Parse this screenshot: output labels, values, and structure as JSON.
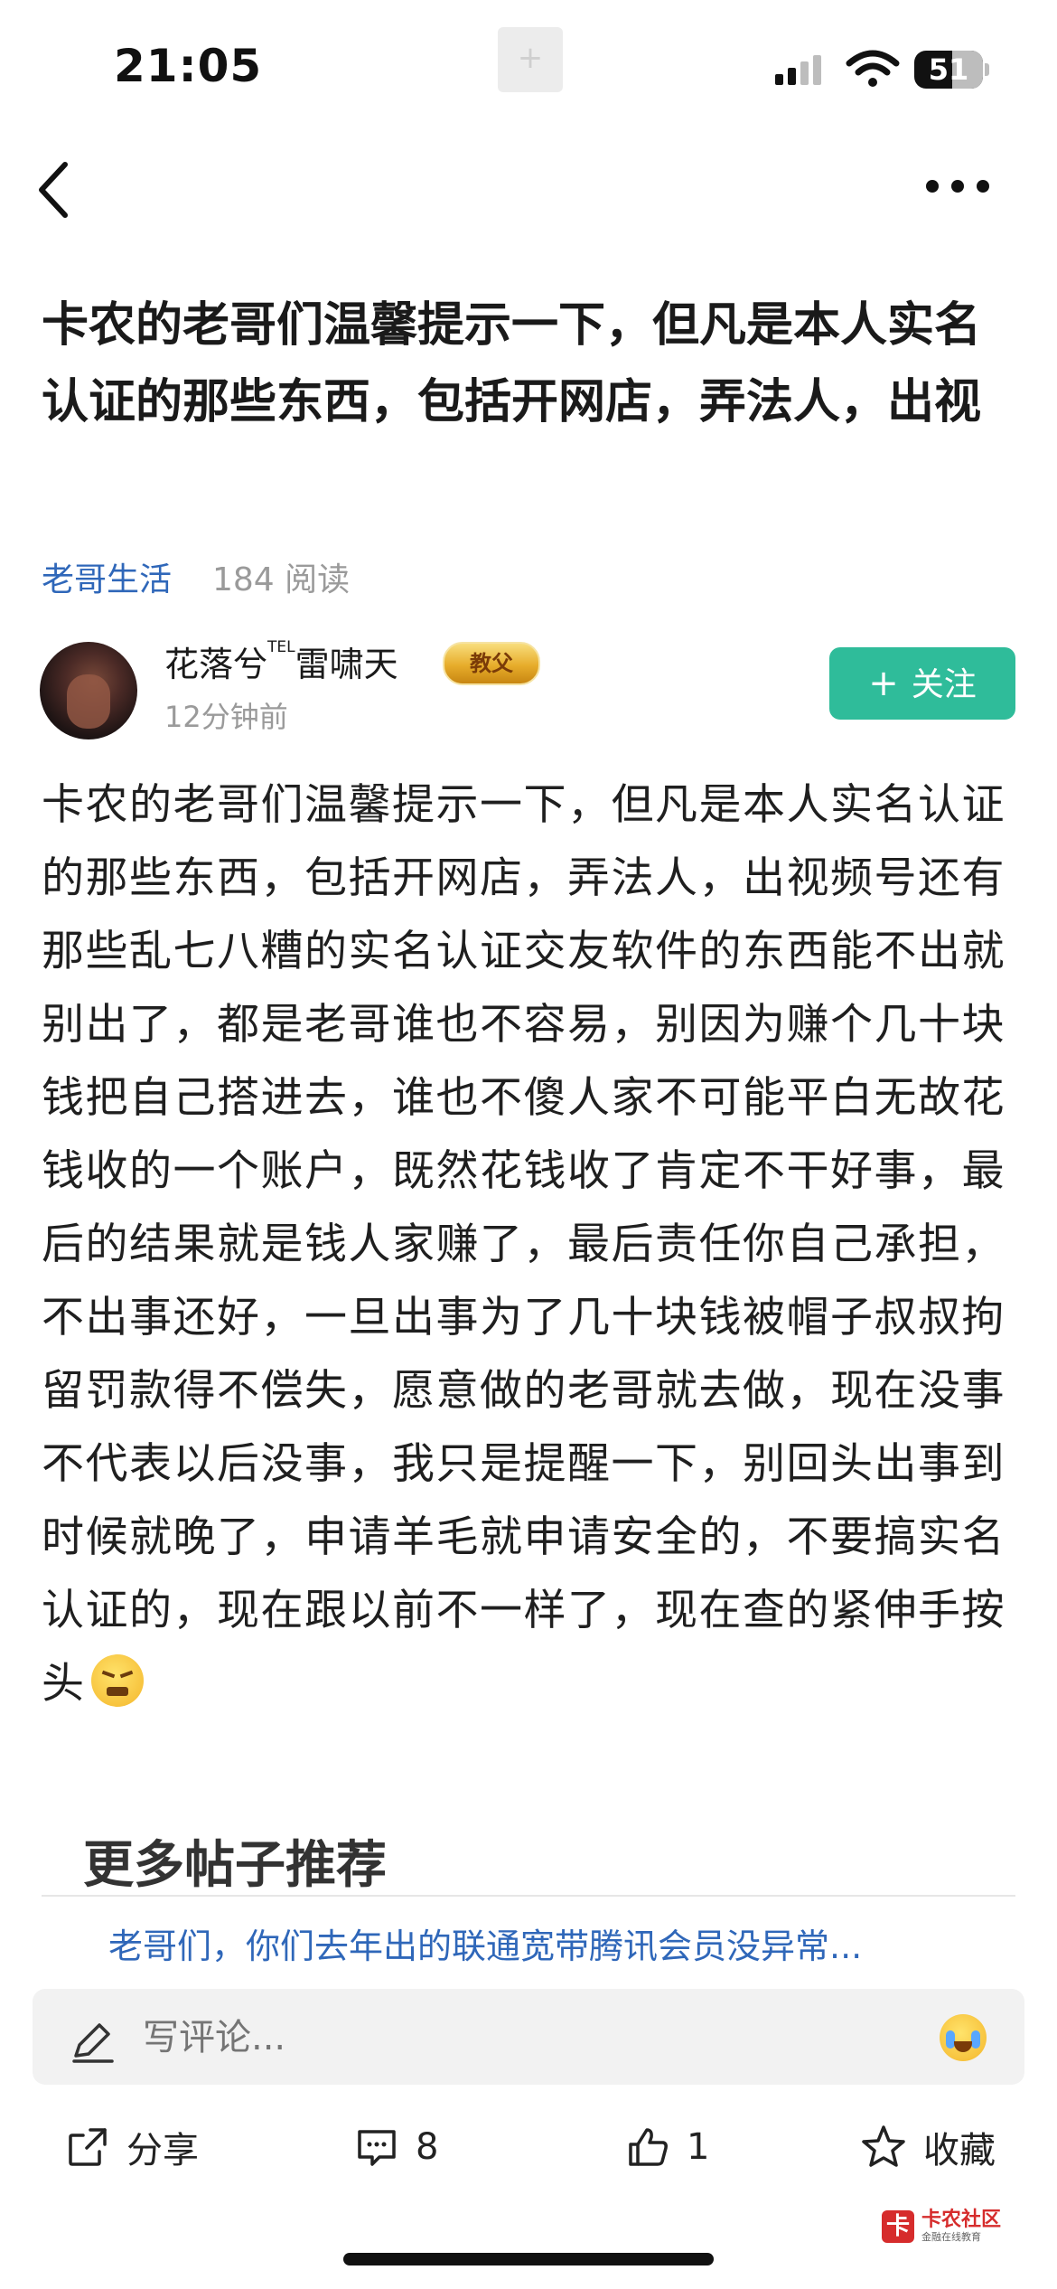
{
  "status_bar": {
    "time": "21:05",
    "center_glyph": "+",
    "battery": "51"
  },
  "post": {
    "title": "卡农的老哥们温馨提示一下，但凡是本人实名认证的那些东西，包括开网店，弄法人，出视",
    "category": "老哥生活",
    "read_count": "184 阅读",
    "author": {
      "name": "花落兮",
      "tel": "TEL",
      "name_suffix": "雷啸天",
      "badge": "教父",
      "time": "12分钟前"
    },
    "follow_label": "关注",
    "body": "卡农的老哥们温馨提示一下，但凡是本人实名认证的那些东西，包括开网店，弄法人，出视频号还有那些乱七八糟的实名认证交友软件的东西能不出就别出了，都是老哥谁也不容易，别因为赚个几十块钱把自己搭进去，谁也不傻人家不可能平白无故花钱收的一个账户，既然花钱收了肯定不干好事，最后的结果就是钱人家赚了，最后责任你自己承担，不出事还好，一旦出事为了几十块钱被帽子叔叔拘留罚款得不偿失，愿意做的老哥就去做，现在没事不代表以后没事，我只是提醒一下，别回头出事到时候就晚了，申请羊毛就申请安全的，不要搞实名认证的，现在跟以前不一样了，现在查的紧伸手按头"
  },
  "more_posts": {
    "title": "更多帖子推荐",
    "items": [
      "老哥们，你们去年出的联通宽带腾讯会员没异常..."
    ]
  },
  "comment": {
    "placeholder": "写评论..."
  },
  "actions": {
    "share": "分享",
    "comments": "8",
    "likes": "1",
    "favorite": "收藏"
  },
  "watermark": {
    "logo": "卡",
    "title": "卡农社区",
    "subtitle": "金融在线教育"
  },
  "colors": {
    "link": "#2f67b9",
    "follow": "#2fbc9a"
  }
}
